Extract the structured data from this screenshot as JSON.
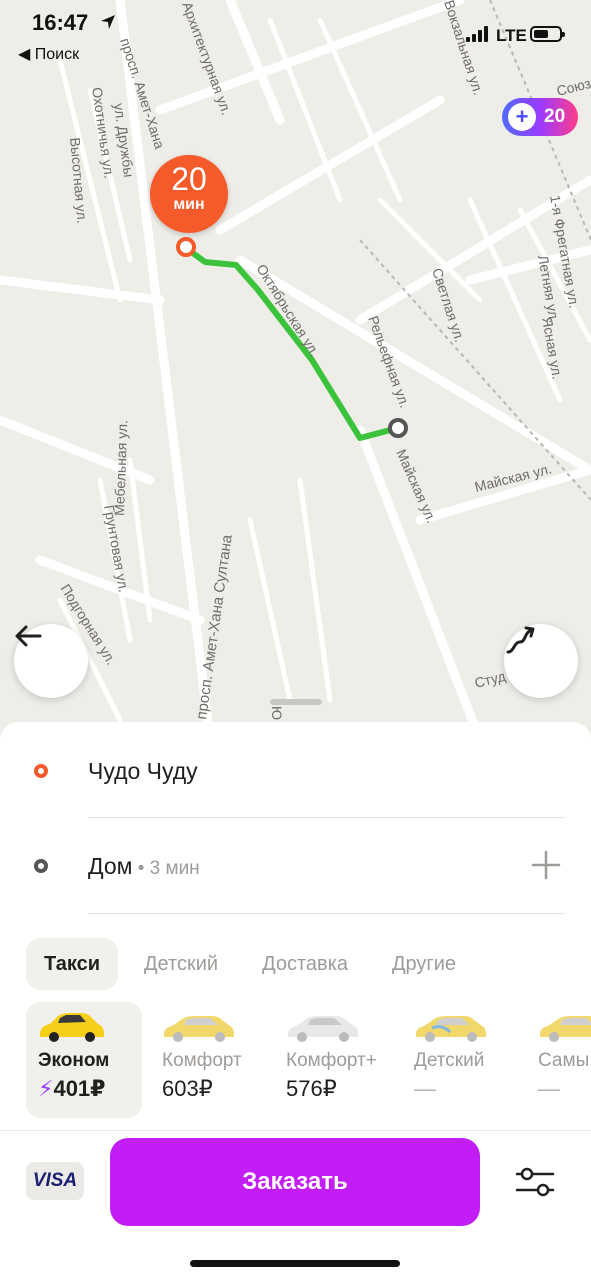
{
  "status_bar": {
    "time": "16:47",
    "back_label": "◀ Поиск",
    "network": "LTE"
  },
  "map": {
    "eta_value": "20",
    "eta_unit": "мин",
    "plus_points": "20",
    "street_labels": [
      "просп. Амет-Хана",
      "Охотничья ул.",
      "ул. Дружбы",
      "Высотная ул.",
      "Архитектурная ул.",
      "Октябрьская ул.",
      "Рельефная ул.",
      "Майская ул.",
      "Светлая ул.",
      "1-я Фрегатная ул.",
      "Летняя ул.",
      "Ясная ул.",
      "Грунтовая ул.",
      "Мебельная ул.",
      "Подгорная ул.",
      "просп. Амет-Хана Султана",
      "Майская ул.",
      "Студ",
      "Союз",
      "Вокзальная ул.",
      "Ю"
    ],
    "route_color": "#3bc43b"
  },
  "route": {
    "from": {
      "name": "Чудо Чуду",
      "color": "#f45a2a"
    },
    "to": {
      "name": "Дом",
      "extra": " • 3 мин",
      "color": "#555555"
    }
  },
  "tabs": [
    {
      "label": "Такси",
      "active": true
    },
    {
      "label": "Детский",
      "active": false
    },
    {
      "label": "Доставка",
      "active": false
    },
    {
      "label": "Другие",
      "active": false
    }
  ],
  "tariffs": [
    {
      "name": "Эконом",
      "price": "401₽",
      "boost": "⚡",
      "active": true,
      "car_color": "#f5cf1a"
    },
    {
      "name": "Комфорт",
      "price": "603₽",
      "active": false,
      "car_color": "#f2d76a"
    },
    {
      "name": "Комфорт+",
      "price": "576₽",
      "active": false,
      "car_color": "#e8e8e8"
    },
    {
      "name": "Детский",
      "price": "—",
      "active": false,
      "car_color": "#f2d76a"
    },
    {
      "name": "Самы",
      "price": "—",
      "active": false,
      "car_color": "#f2d76a"
    }
  ],
  "payment": {
    "card_label": "VISA"
  },
  "order_button": {
    "label": "Заказать",
    "color": "#c21df5"
  }
}
